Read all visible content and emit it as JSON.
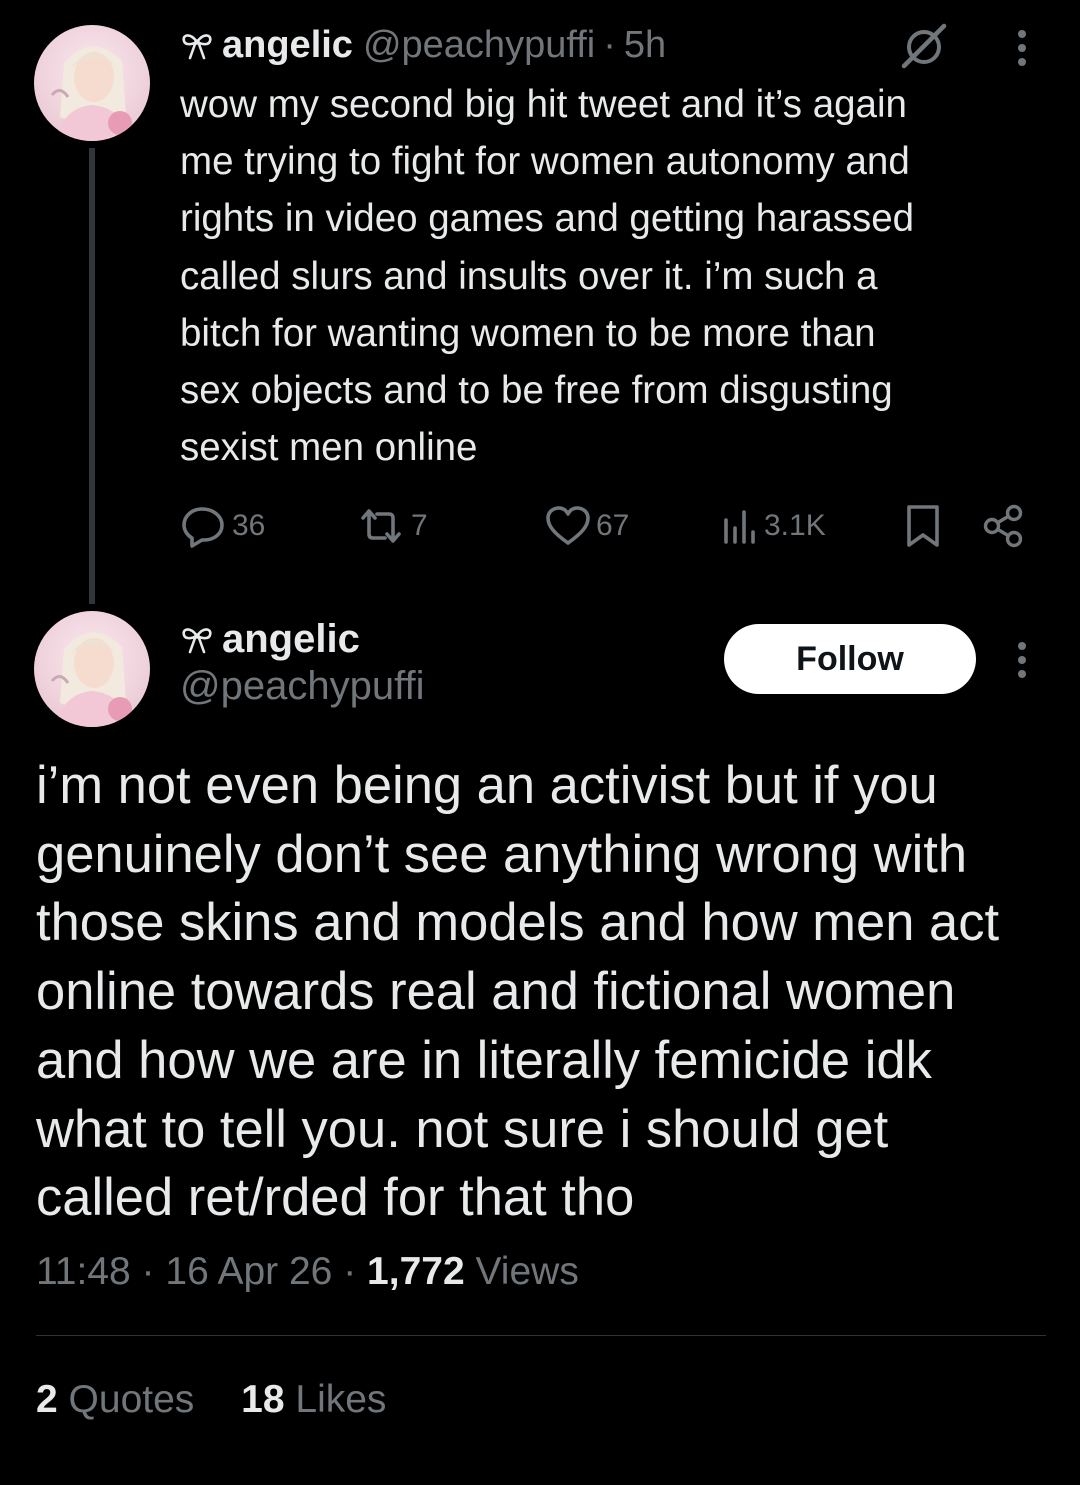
{
  "parent_tweet": {
    "display_name": "angelic",
    "handle": "@peachypuffi",
    "separator": "·",
    "time": "5h",
    "text": "wow my second big hit tweet and it’s again\nme trying to fight for women autonomy and\nrights in video games and getting harassed\ncalled slurs and insults over it. i’m such a\nbitch for wanting women to be more than\nsex objects and to be free from disgusting\nsexist men online",
    "actions": {
      "replies": "36",
      "reposts": "7",
      "likes": "67",
      "views": "3.1K"
    }
  },
  "focused_tweet": {
    "display_name": "angelic",
    "handle": "@peachypuffi",
    "follow_label": "Follow",
    "text": "i’m not even being an activist but if you\ngenuinely don’t see anything wrong with\nthose skins and models and how men act\nonline towards real and fictional women\nand how we are in literally femicide idk\nwhat to tell you. not sure i should get\ncalled ret/rded for that tho",
    "time": "11:48",
    "date": "16 Apr 26",
    "separator": "·",
    "views_count": "1,772",
    "views_label": "Views",
    "quotes_count": "2",
    "quotes_label": "Quotes",
    "likes_count": "18",
    "likes_label": "Likes"
  },
  "icons": {
    "bow": "bow-emoji-icon",
    "grok": "grok-icon",
    "more": "more-vertical-icon",
    "reply": "reply-icon",
    "repost": "repost-icon",
    "like": "heart-icon",
    "views": "views-chart-icon",
    "bookmark": "bookmark-icon",
    "share": "share-icon"
  },
  "colors": {
    "background": "#000000",
    "text_primary": "#e7e9ea",
    "text_secondary": "#71767b",
    "divider": "#2f3336",
    "follow_button_bg": "#ffffff",
    "follow_button_text": "#0f1419"
  }
}
